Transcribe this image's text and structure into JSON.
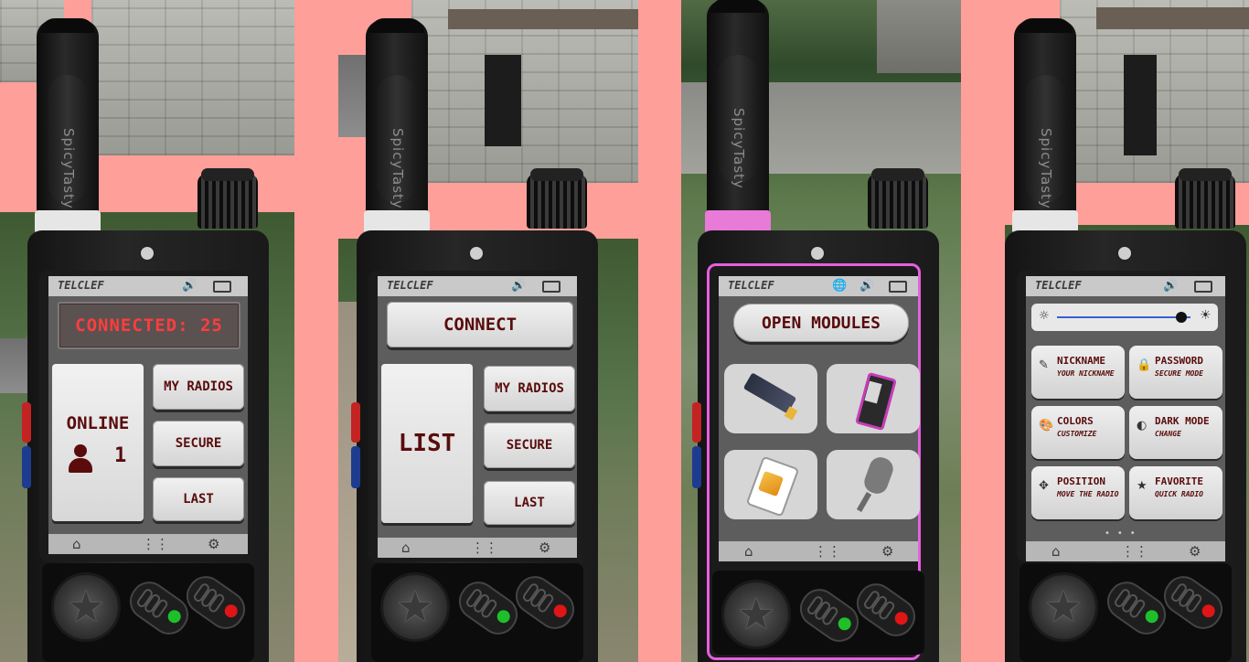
{
  "colors": {
    "background": "#ff9f9a",
    "lcd_text": "#ff3d3d",
    "button_text": "#5a0c0c",
    "pink_ring": "#e85ee0",
    "led_green": "#1fbf2a",
    "led_red": "#e01515"
  },
  "brand": "SpicyTasty",
  "statusbar": {
    "label": "TELCLEF",
    "sound_icon": "speaker-icon",
    "battery_icon": "battery-icon",
    "globe_icon": "globe-icon"
  },
  "navbar": {
    "home_icon": "home-icon",
    "apps_icon": "apps-grid-icon",
    "settings_icon": "gear-icon"
  },
  "panel1": {
    "lcd": "CONNECTED: 25",
    "online_label": "ONLINE",
    "online_count": "1",
    "my_radios": "MY RADIOS",
    "secure": "SECURE",
    "last": "LAST"
  },
  "panel2": {
    "connect": "CONNECT",
    "list": "LIST",
    "my_radios": "MY RADIOS",
    "secure": "SECURE",
    "last": "LAST"
  },
  "panel3": {
    "open_modules": "OPEN MODULES",
    "modules": [
      "battery-module-icon",
      "radio-skin-module-icon",
      "sim-card-module-icon",
      "microphone-module-icon"
    ]
  },
  "panel4": {
    "volume_level": 0.93,
    "settings": [
      {
        "title": "NICKNAME",
        "sub": "YOUR NICKNAME",
        "icon": "edit-icon"
      },
      {
        "title": "PASSWORD",
        "sub": "SECURE MODE",
        "icon": "user-lock-icon"
      },
      {
        "title": "COLORS",
        "sub": "CUSTOMIZE",
        "icon": "palette-icon"
      },
      {
        "title": "DARK MODE",
        "sub": "CHANGE",
        "icon": "contrast-icon"
      },
      {
        "title": "POSITION",
        "sub": "MOVE THE RADIO",
        "icon": "move-icon"
      },
      {
        "title": "FAVORITE",
        "sub": "QUICK RADIO",
        "icon": "star-icon"
      }
    ]
  }
}
